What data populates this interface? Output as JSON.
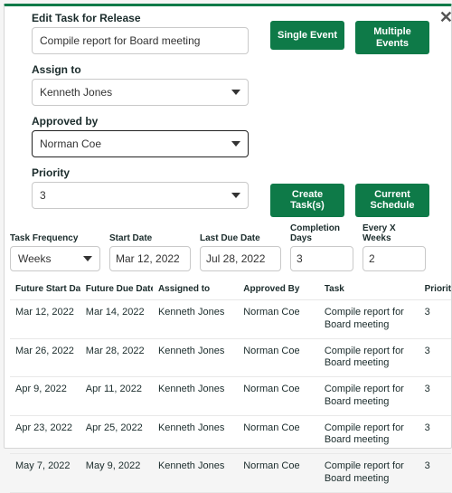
{
  "colors": {
    "accent": "#0e7a48"
  },
  "header": {
    "title": "Edit Task for Release",
    "task_name": "Compile report for Board meeting"
  },
  "buttons": {
    "single_event": "Single Event",
    "multiple_events": "Multiple Events",
    "create_tasks": "Create Task(s)",
    "current_schedule": "Current Schedule"
  },
  "fields": {
    "assign_label": "Assign to",
    "assign_value": "Kenneth Jones",
    "approved_label": "Approved by",
    "approved_value": "Norman Coe",
    "priority_label": "Priority",
    "priority_value": "3"
  },
  "params": {
    "freq_label": "Task Frequency",
    "freq_value": "Weeks",
    "start_label": "Start Date",
    "start_value": "Mar 12, 2022",
    "last_label": "Last Due Date",
    "last_value": "Jul 28, 2022",
    "comp_label": "Completion Days",
    "comp_value": "3",
    "every_label": "Every X Weeks",
    "every_value": "2"
  },
  "grid": {
    "headers": {
      "fsd": "Future Start Dates",
      "fdd": "Future Due Dates",
      "ass": "Assigned to",
      "app": "Approved By",
      "task": "Task",
      "prio": "Priority"
    },
    "rows": [
      {
        "fsd": "Mar 12, 2022",
        "fdd": "Mar 14, 2022",
        "ass": "Kenneth Jones",
        "app": "Norman Coe",
        "task": "Compile report for Board meeting",
        "prio": "3"
      },
      {
        "fsd": "Mar 26, 2022",
        "fdd": "Mar 28, 2022",
        "ass": "Kenneth Jones",
        "app": "Norman Coe",
        "task": "Compile report for Board meeting",
        "prio": "3"
      },
      {
        "fsd": "Apr 9, 2022",
        "fdd": "Apr 11, 2022",
        "ass": "Kenneth Jones",
        "app": "Norman Coe",
        "task": "Compile report for Board meeting",
        "prio": "3"
      },
      {
        "fsd": "Apr 23, 2022",
        "fdd": "Apr 25, 2022",
        "ass": "Kenneth Jones",
        "app": "Norman Coe",
        "task": "Compile report for Board meeting",
        "prio": "3"
      },
      {
        "fsd": "May 7, 2022",
        "fdd": "May 9, 2022",
        "ass": "Kenneth Jones",
        "app": "Norman Coe",
        "task": "Compile report for Board meeting",
        "prio": "3"
      }
    ]
  }
}
